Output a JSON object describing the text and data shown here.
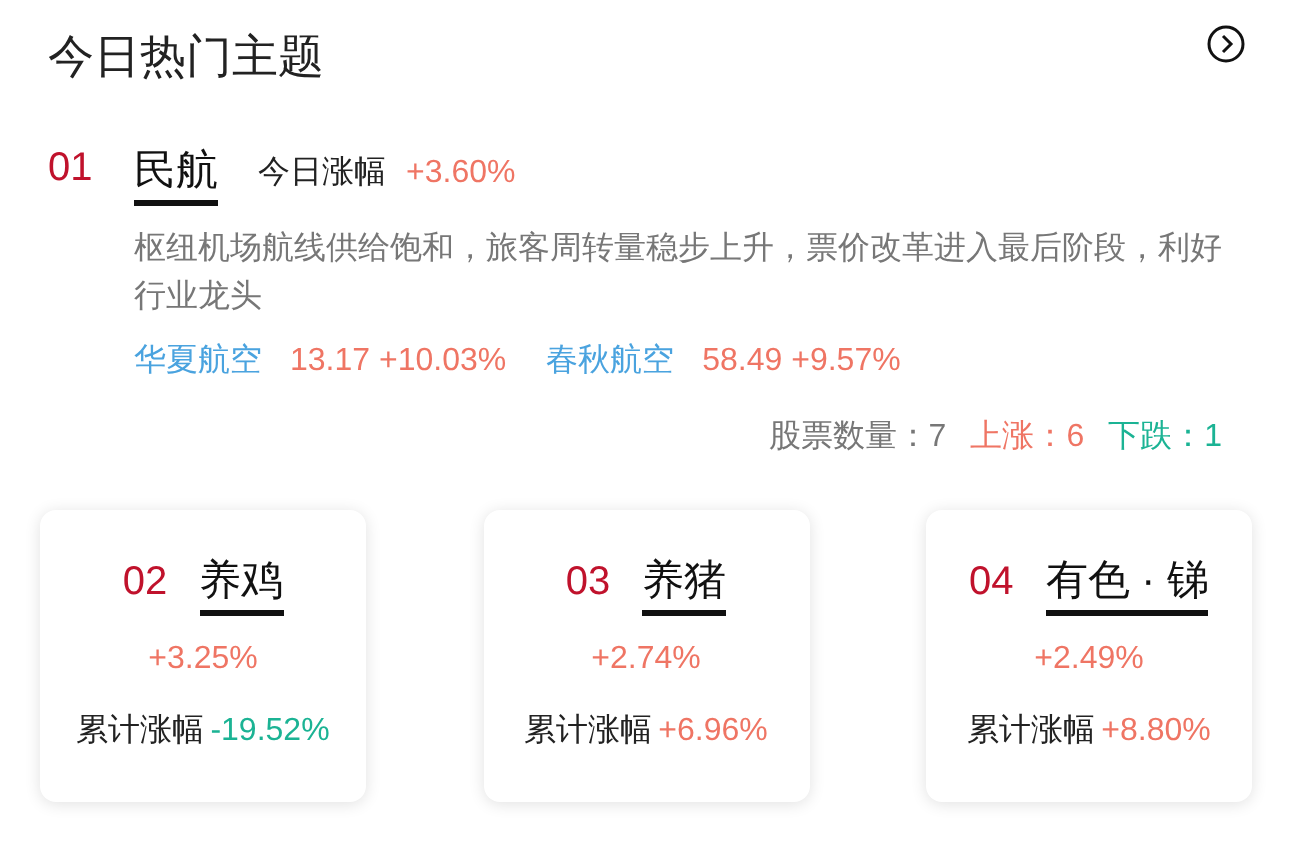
{
  "title": "今日热门主题",
  "featured": {
    "rank": "01",
    "name": "民航",
    "change_label": "今日涨幅",
    "change": "+3.60%",
    "description": "枢纽机场航线供给饱和，旅客周转量稳步上升，票价改革进入最后阶段，利好行业龙头",
    "stocks": [
      {
        "name": "华夏航空",
        "price": "13.17",
        "change": "+10.03%"
      },
      {
        "name": "春秋航空",
        "price": "58.49",
        "change": "+9.57%"
      }
    ],
    "counts": {
      "total_label": "股票数量：",
      "total": "7",
      "up_label": "上涨：",
      "up": "6",
      "down_label": "下跌：",
      "down": "1"
    }
  },
  "cards": [
    {
      "rank": "02",
      "name": "养鸡",
      "change": "+3.25%",
      "cumulative_label": "累计涨幅",
      "cumulative": "-19.52%",
      "color": "#1bb394"
    },
    {
      "rank": "03",
      "name": "养猪",
      "change": "+2.74%",
      "cumulative_label": "累计涨幅",
      "cumulative": "+6.96%",
      "color": "#ef7564"
    },
    {
      "rank": "04",
      "name": "有色 · 锑",
      "change": "+2.49%",
      "cumulative_label": "累计涨幅",
      "cumulative": "+8.80%",
      "color": "#ef7564"
    }
  ]
}
